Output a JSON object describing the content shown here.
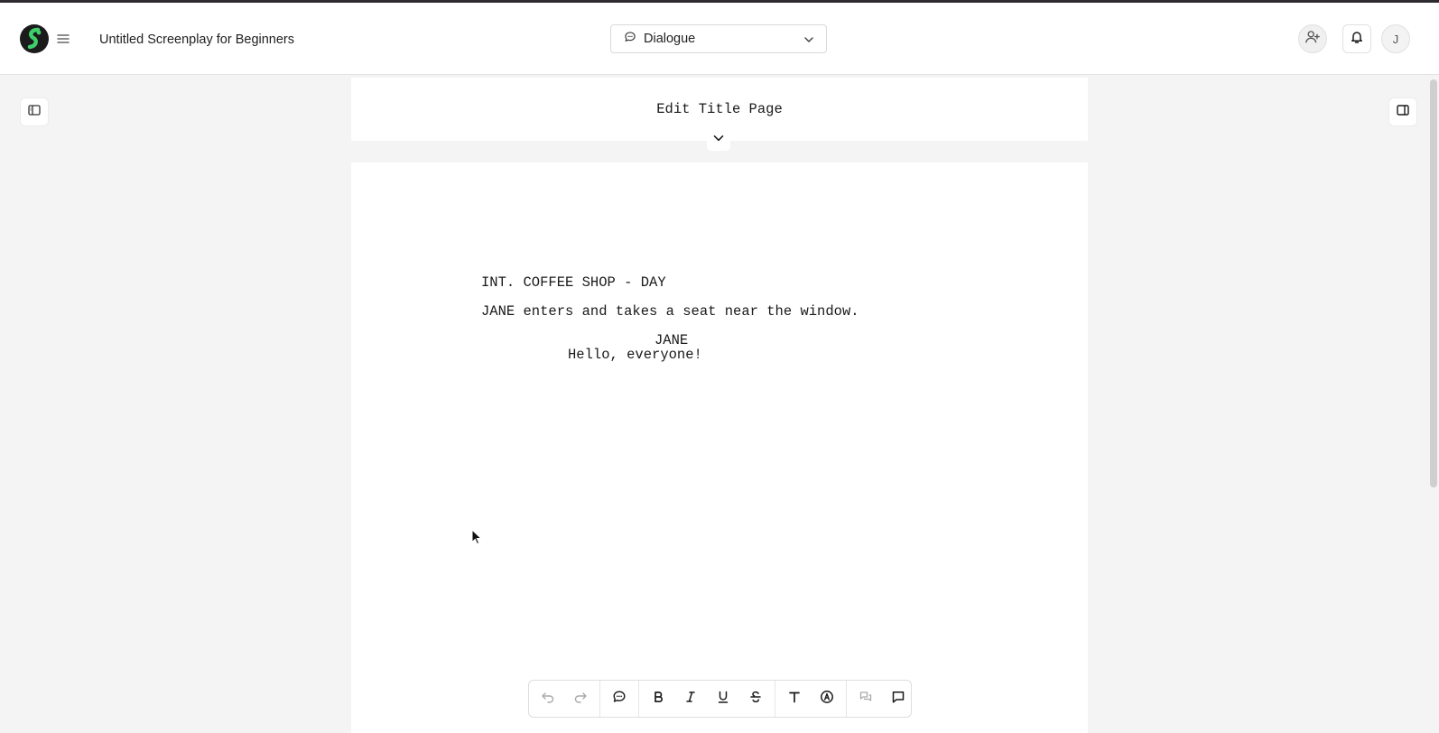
{
  "header": {
    "doc_title": "Untitled Screenplay for Beginners",
    "element_type": "Dialogue",
    "avatar_initial": "J"
  },
  "title_page": {
    "label": "Edit Title Page"
  },
  "script": {
    "scene_heading": "INT. COFFEE SHOP - DAY",
    "action": "JANE enters and takes a seat near the window.",
    "character": "JANE",
    "dialogue": "Hello, everyone!"
  },
  "icons": {
    "logo": "app-logo",
    "menu": "hamburger-icon",
    "element_type": "speech-bubble-icon",
    "dropdown": "chevron-down-icon",
    "add_collaborator": "user-plus-icon",
    "notifications": "bell-icon",
    "left_panel": "sidebar-left-icon",
    "right_panel": "sidebar-right-icon",
    "expand": "chevron-down-icon",
    "toolbar": [
      "undo-icon",
      "redo-icon",
      "dialogue-icon",
      "bold-icon",
      "italic-icon",
      "underline-icon",
      "strikethrough-icon",
      "text-icon",
      "circled-a-icon",
      "chat-icon",
      "comment-icon"
    ]
  },
  "colors": {
    "logo_accent": "#3ecf6b",
    "canvas": "#f4f4f4",
    "page": "#ffffff"
  }
}
